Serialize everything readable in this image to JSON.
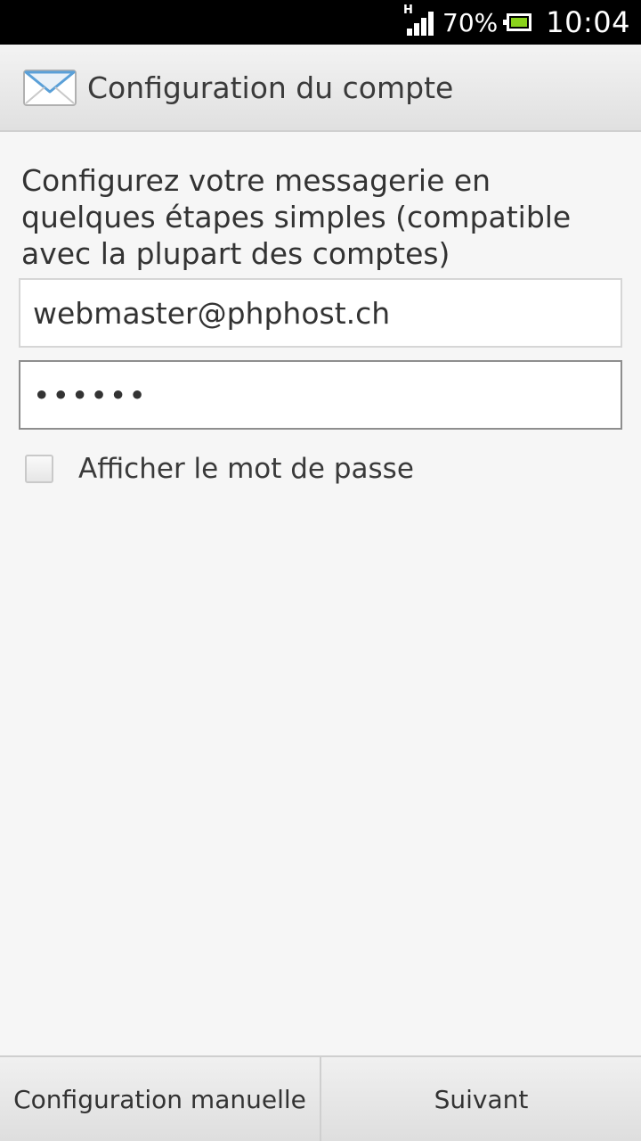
{
  "status_bar": {
    "network": "H",
    "battery_percent": "70%",
    "time": "10:04"
  },
  "header": {
    "title": "Configuration du compte",
    "icon": "mail-icon"
  },
  "main": {
    "intro_text": "Configurez votre messagerie en quelques étapes simples (compatible avec la plupart des comptes)",
    "email_value": "webmaster@phphost.ch",
    "password_value": "••••••",
    "show_password_label": "Afficher le mot de passe"
  },
  "footer": {
    "manual_button": "Configuration manuelle",
    "next_button": "Suivant"
  },
  "colors": {
    "battery_fill": "#8ad21b",
    "background": "#f6f6f6"
  }
}
